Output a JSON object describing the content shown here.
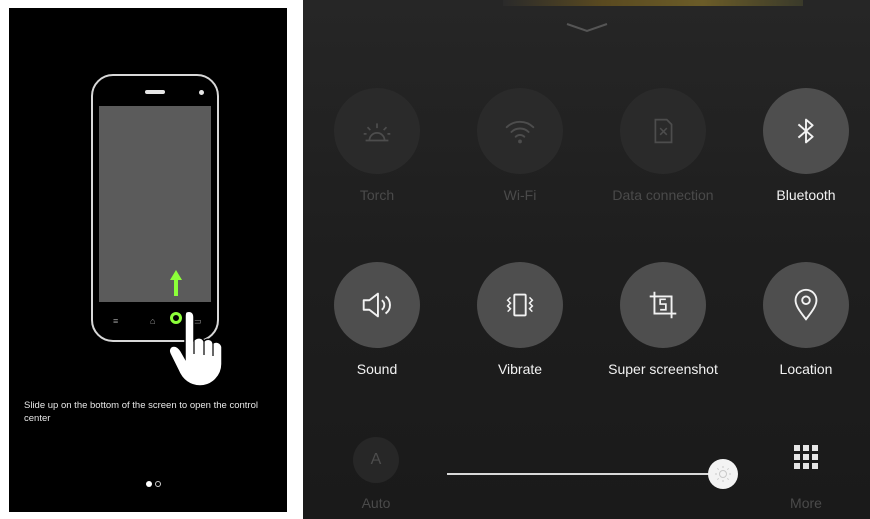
{
  "tutorial": {
    "hint_text": "Slide up on the bottom of the screen to open the control center",
    "page_index": 1,
    "page_count": 2,
    "highlight_color": "#8cff39"
  },
  "control_center": {
    "tiles": [
      {
        "label": "Torch",
        "icon": "torch-icon",
        "active": false
      },
      {
        "label": "Wi-Fi",
        "icon": "wifi-icon",
        "active": false
      },
      {
        "label": "Data connection",
        "icon": "data-connection-icon",
        "active": false
      },
      {
        "label": "Bluetooth",
        "icon": "bluetooth-icon",
        "active": true
      },
      {
        "label": "Sound",
        "icon": "sound-icon",
        "active": true
      },
      {
        "label": "Vibrate",
        "icon": "vibrate-icon",
        "active": true
      },
      {
        "label": "Super screenshot",
        "icon": "super-screenshot-icon",
        "active": true
      },
      {
        "label": "Location",
        "icon": "location-icon",
        "active": true
      }
    ],
    "brightness": {
      "auto_glyph": "A",
      "auto_label": "Auto",
      "auto_enabled": false,
      "level": 0.95
    },
    "more_label": "More"
  }
}
